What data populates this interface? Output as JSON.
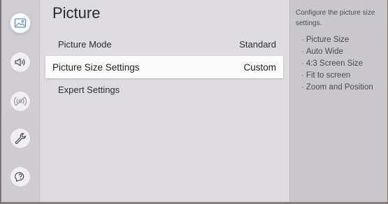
{
  "sidebar": {
    "items": [
      {
        "icon": "picture-icon",
        "active": true
      },
      {
        "icon": "sound-icon",
        "active": false
      },
      {
        "icon": "broadcasting-icon",
        "active": false
      },
      {
        "icon": "wrench-icon",
        "active": false
      },
      {
        "icon": "support-icon",
        "active": false
      }
    ]
  },
  "main": {
    "title": "Picture",
    "menu": [
      {
        "label": "Picture Mode",
        "value": "Standard"
      },
      {
        "label": "Picture Size Settings",
        "value": "Custom"
      },
      {
        "label": "Expert Settings",
        "value": ""
      }
    ]
  },
  "help": {
    "description": "Configure the picture size settings.",
    "items": [
      "Picture Size",
      "Auto Wide",
      "4:3 Screen Size",
      "Fit to screen",
      "Zoom and Position"
    ]
  },
  "colors": {
    "accent": "#5b8fc4",
    "background": "#d9d7da",
    "selected_row": "#fafafa"
  }
}
